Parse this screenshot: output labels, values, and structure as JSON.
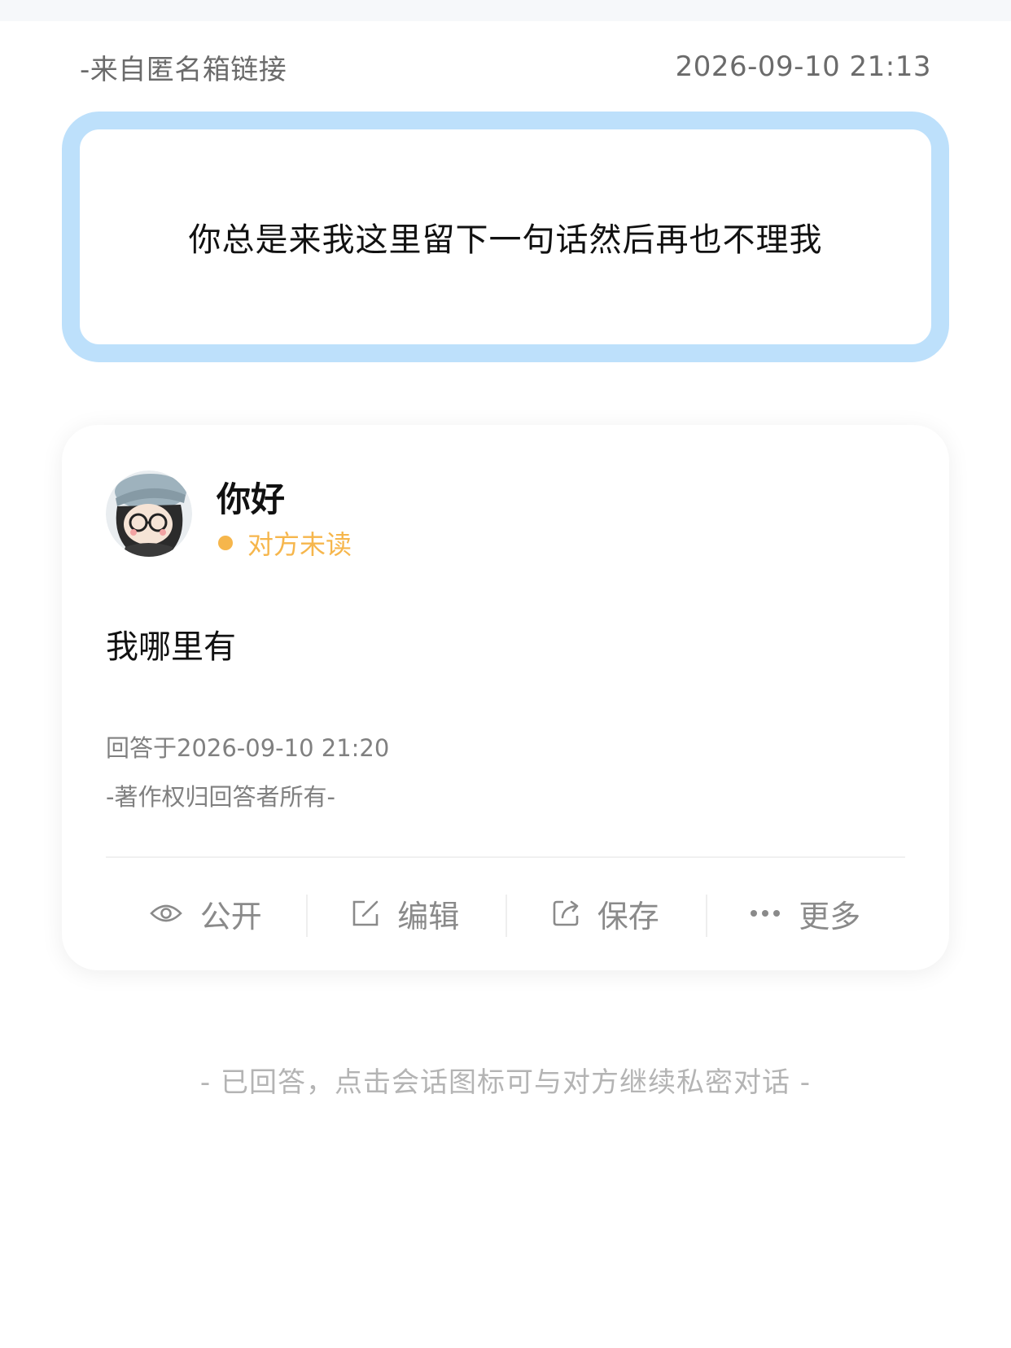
{
  "header": {
    "source": "-来自匿名箱链接",
    "timestamp": "2026-09-10 21:13"
  },
  "question": {
    "text": "你总是来我这里留下一句话然后再也不理我"
  },
  "answer": {
    "user_name": "你好",
    "read_status": "对方未读",
    "text": "我哪里有",
    "answered_at": "回答于2026-09-10 21:20",
    "copyright": "-著作权归回答者所有-"
  },
  "actions": [
    {
      "label": "公开",
      "icon": "eye-icon"
    },
    {
      "label": "编辑",
      "icon": "edit-icon"
    },
    {
      "label": "保存",
      "icon": "share-icon"
    },
    {
      "label": "更多",
      "icon": "more-dots-icon"
    }
  ],
  "footer": {
    "hint": "- 已回答，点击会话图标可与对方继续私密对话 -"
  },
  "colors": {
    "question_border": "#bde0fb",
    "status_accent": "#f6b64c",
    "muted_text": "#8a8a8a"
  }
}
